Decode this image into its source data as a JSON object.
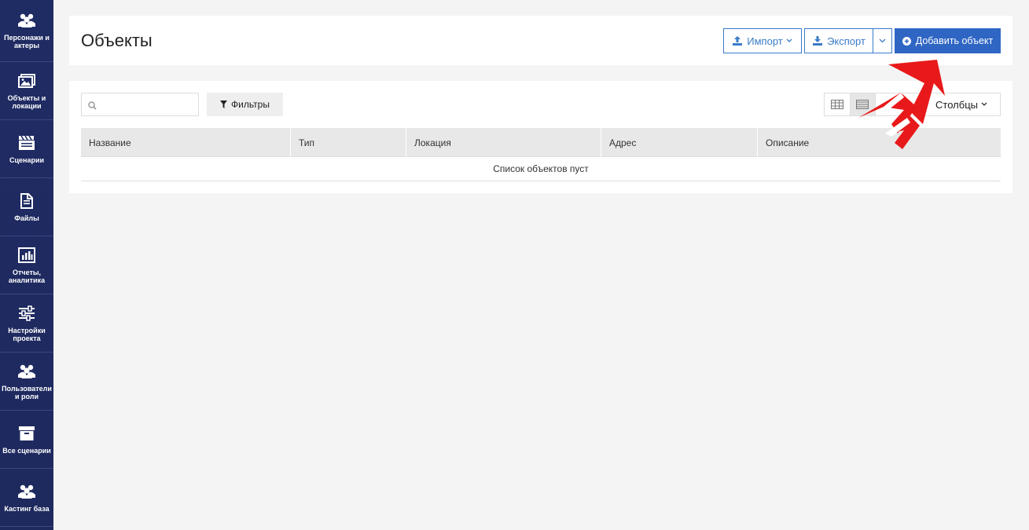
{
  "sidebar": {
    "items": [
      {
        "label": "Персонажи и актеры",
        "icon": "users-icon"
      },
      {
        "label": "Объекты и локации",
        "icon": "images-icon"
      },
      {
        "label": "Сценарии",
        "icon": "clapperboard-icon"
      },
      {
        "label": "Файлы",
        "icon": "file-icon"
      },
      {
        "label": "Отчеты, аналитика",
        "icon": "bar-chart-icon"
      },
      {
        "label": "Настройки проекта",
        "icon": "sliders-icon"
      },
      {
        "label": "Пользователи и роли",
        "icon": "users-icon"
      },
      {
        "label": "Все сценарии",
        "icon": "archive-icon"
      },
      {
        "label": "Кастинг база",
        "icon": "users-icon"
      }
    ]
  },
  "header": {
    "title": "Объекты",
    "import_label": "Импорт",
    "export_label": "Экспорт",
    "add_label": "Добавить объект"
  },
  "toolbar": {
    "search_value": "",
    "filter_label": "Фильтры",
    "columns_label": "Столбцы"
  },
  "table": {
    "columns": [
      "Название",
      "Тип",
      "Локация",
      "Адрес",
      "Описание"
    ],
    "empty_text": "Список объектов пуст"
  },
  "colors": {
    "sidebar_bg": "#1f2b63",
    "primary": "#2f66c4",
    "outline": "#3a7bc8",
    "annotation_arrow": "#e8191a"
  }
}
